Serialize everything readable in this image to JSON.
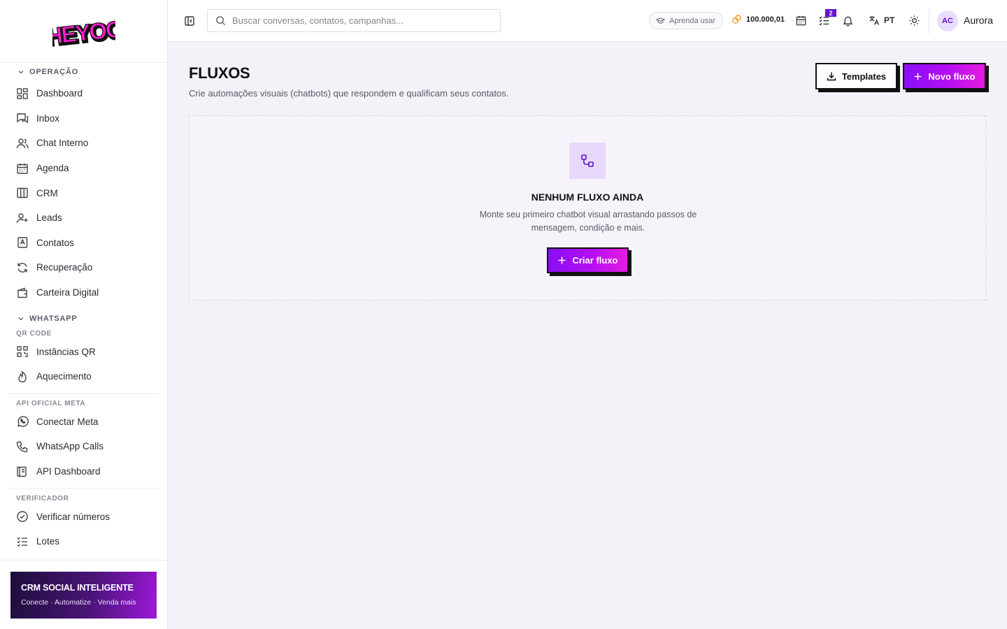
{
  "brand": {
    "logo_text": "HEYOO"
  },
  "sidebar": {
    "groups": [
      {
        "label": "OPERAÇÃO",
        "items": [
          {
            "label": "Dashboard",
            "icon": "dashboard-icon"
          },
          {
            "label": "Inbox",
            "icon": "inbox-icon"
          },
          {
            "label": "Chat Interno",
            "icon": "users-icon"
          },
          {
            "label": "Agenda",
            "icon": "calendar-icon"
          },
          {
            "label": "CRM",
            "icon": "kanban-icon"
          },
          {
            "label": "Leads",
            "icon": "user-plus-icon"
          },
          {
            "label": "Contatos",
            "icon": "contact-book-icon"
          },
          {
            "label": "Recuperação",
            "icon": "refresh-icon"
          },
          {
            "label": "Carteira Digital",
            "icon": "wallet-icon"
          }
        ]
      },
      {
        "label": "WHATSAPP",
        "sections": [
          {
            "label": "QR CODE",
            "items": [
              {
                "label": "Instâncias QR",
                "icon": "qr-code-icon"
              },
              {
                "label": "Aquecimento",
                "icon": "flame-icon"
              }
            ]
          },
          {
            "label": "API OFICIAL META",
            "items": [
              {
                "label": "Conectar Meta",
                "icon": "whatsapp-icon"
              },
              {
                "label": "WhatsApp Calls",
                "icon": "phone-icon"
              },
              {
                "label": "API Dashboard",
                "icon": "scroll-icon"
              }
            ]
          },
          {
            "label": "VERIFICADOR",
            "items": [
              {
                "label": "Verificar números",
                "icon": "check-circle-icon"
              },
              {
                "label": "Lotes",
                "icon": "list-check-icon"
              }
            ]
          }
        ]
      }
    ],
    "promo": {
      "title": "CRM SOCIAL INTELIGENTE",
      "subtitle": "Conecte · Automatize · Venda mais"
    }
  },
  "topbar": {
    "search_placeholder": "Buscar conversas, contatos, campanhas...",
    "learn_label": "Aprenda usar",
    "credits": "100.000,01",
    "tasks_badge": "2",
    "language": "PT",
    "avatar_initials": "AC",
    "username": "Aurora"
  },
  "main": {
    "title": "FLUXOS",
    "subtitle": "Crie automações visuais (chatbots) que respondem e qualificam seus contatos.",
    "templates_label": "Templates",
    "new_flow_label": "Novo fluxo",
    "empty": {
      "title": "NENHUM FLUXO AINDA",
      "description": "Monte seu primeiro chatbot visual arrastando passos de mensagem, condição e mais.",
      "create_label": "Criar fluxo"
    }
  },
  "colors": {
    "accent": "#8a0ef5",
    "accent_end": "#e51ce0",
    "brand_pink": "#ff1fd2"
  }
}
